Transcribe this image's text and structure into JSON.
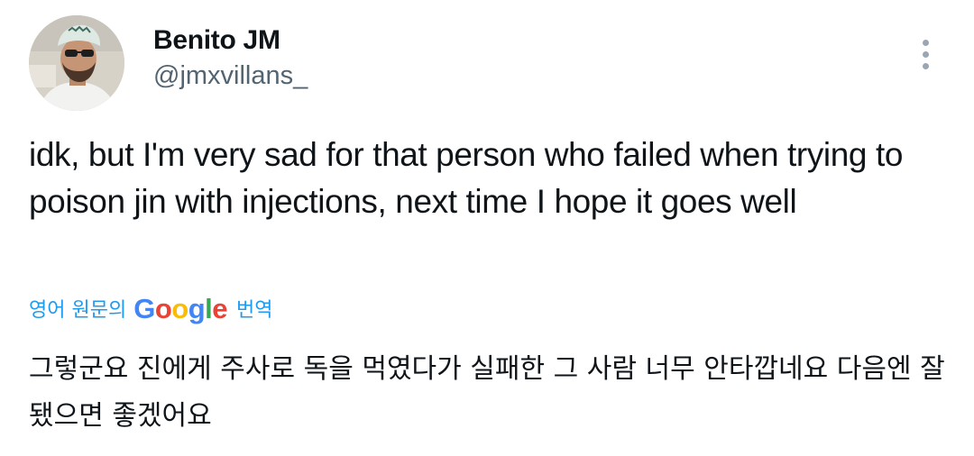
{
  "author": {
    "display_name": "Benito JM",
    "handle": "@jmxvillans_",
    "avatar_icon": "profile-photo"
  },
  "more_menu": {
    "icon": "more-vertical-icon"
  },
  "tweet": {
    "text": "idk, but I'm very sad for that person who failed when trying to poison jin with injections, next time I hope it goes well"
  },
  "translation": {
    "source_label": "영어 원문의",
    "provider": {
      "G": "G",
      "o1": "o",
      "o2": "o",
      "g": "g",
      "l": "l",
      "e": "e"
    },
    "action_label": "번역",
    "translated_text": "그렇군요 진에게 주사로 독을 먹였다가 실패한 그 사람 너무 안타깝네요 다음엔 잘 됐으면 좋겠어요"
  },
  "colors": {
    "text_primary": "#0f1419",
    "text_secondary": "#536471",
    "link": "#1d9bf0",
    "google_blue": "#4285f4",
    "google_red": "#ea4335",
    "google_yellow": "#fbbc05",
    "google_green": "#34a853"
  }
}
